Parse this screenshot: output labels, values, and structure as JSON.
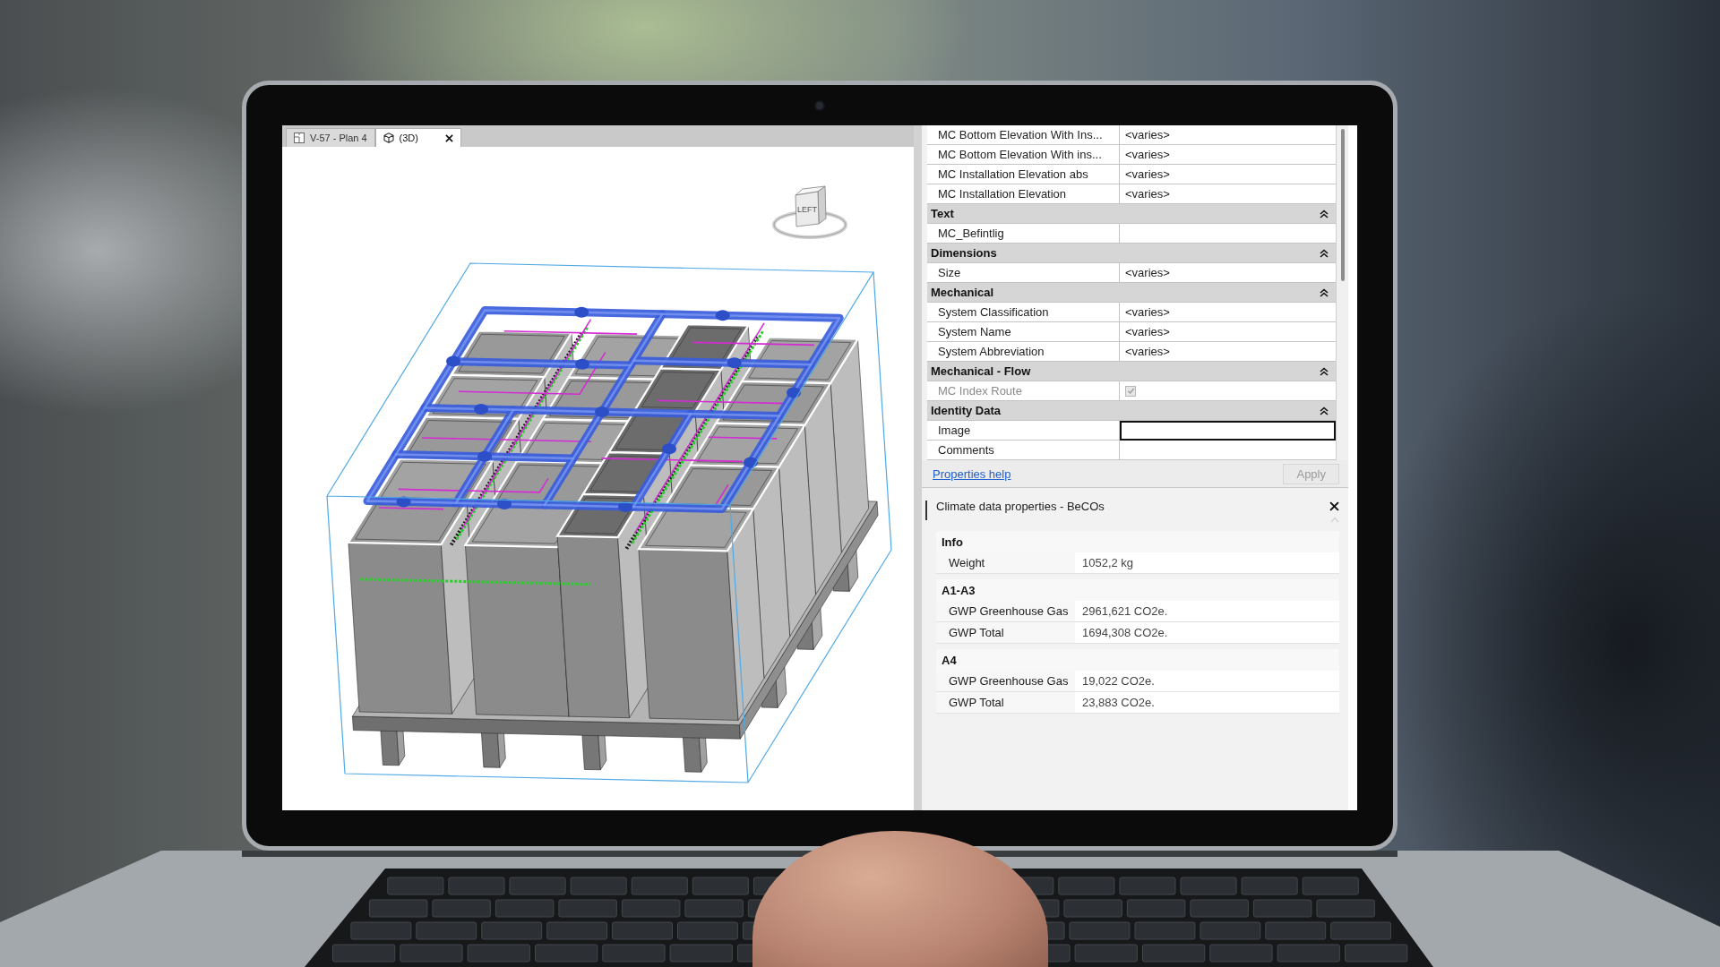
{
  "view_tabs": [
    {
      "label": "V-57 - Plan 4",
      "kind": "plan",
      "selected": false
    },
    {
      "label": "(3D)",
      "kind": "model",
      "selected": true
    }
  ],
  "viewcube": {
    "face": "LEFT"
  },
  "properties": {
    "rows": [
      {
        "kind": "param",
        "name": "MC Bottom Elevation With Ins...",
        "value": "<varies>"
      },
      {
        "kind": "param",
        "name": "MC Bottom Elevation With ins...",
        "value": "<varies>"
      },
      {
        "kind": "param",
        "name": "MC Installation Elevation abs",
        "value": "<varies>"
      },
      {
        "kind": "param",
        "name": "MC Installation Elevation",
        "value": "<varies>"
      },
      {
        "kind": "group",
        "name": "Text",
        "expanded": true
      },
      {
        "kind": "param",
        "name": "MC_Befintlig"
      },
      {
        "kind": "group",
        "name": "Dimensions",
        "expanded": true
      },
      {
        "kind": "param",
        "name": "Size",
        "value": "<varies>"
      },
      {
        "kind": "group",
        "name": "Mechanical",
        "expanded": true
      },
      {
        "kind": "param",
        "name": "System Classification",
        "value": "<varies>"
      },
      {
        "kind": "param",
        "name": "System Name",
        "value": "<varies>"
      },
      {
        "kind": "param",
        "name": "System Abbreviation",
        "value": "<varies>"
      },
      {
        "kind": "group",
        "name": "Mechanical - Flow",
        "expanded": true
      },
      {
        "kind": "checkbox",
        "name": "MC Index Route",
        "checked": true,
        "disabled": true
      },
      {
        "kind": "group",
        "name": "Identity Data",
        "expanded": true
      },
      {
        "kind": "input",
        "name": "Image",
        "focused": true
      },
      {
        "kind": "param",
        "name": "Comments"
      }
    ],
    "help_link": "Properties help",
    "apply_button": {
      "label": "Apply",
      "disabled": true
    }
  },
  "climate_panel": {
    "title": "Climate data properties - BeCOs",
    "groups": [
      {
        "name": "Info",
        "rows": [
          {
            "name": "Weight",
            "value": "1052,2 kg"
          }
        ]
      },
      {
        "name": "A1-A3",
        "rows": [
          {
            "name": "GWP Greenhouse Gas",
            "value": "2961,621 CO2e."
          },
          {
            "name": "GWP Total",
            "value": "1694,308 CO2e."
          }
        ]
      },
      {
        "name": "A4",
        "rows": [
          {
            "name": "GWP Greenhouse Gas",
            "value": "19,022 CO2e."
          },
          {
            "name": "GWP Total",
            "value": "23,883 CO2e."
          }
        ]
      }
    ]
  }
}
